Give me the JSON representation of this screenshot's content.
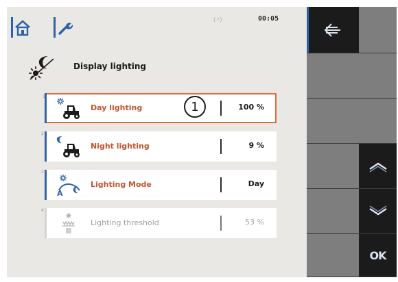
{
  "header": {
    "signal": "(ᵍ)",
    "clock": "00:05"
  },
  "page": {
    "title": "Display lighting"
  },
  "items": [
    {
      "index": "1",
      "label": "Day lighting",
      "value": "100 %",
      "icon": "day-lighting-tractor-icon",
      "state": "selected"
    },
    {
      "index": "2",
      "label": "Night lighting",
      "value": "9 %",
      "icon": "night-lighting-tractor-icon",
      "state": "normal"
    },
    {
      "index": "3",
      "label": "Lighting Mode",
      "value": "Day",
      "icon": "lighting-mode-icon",
      "state": "normal"
    },
    {
      "index": "4",
      "label": "Lighting threshold",
      "value": "53 %",
      "icon": "lighting-threshold-icon",
      "state": "disabled"
    }
  ],
  "callout": "1",
  "softkeys": {
    "back": "back-arrow-icon",
    "up": "chevron-up-icon",
    "down": "chevron-down-icon",
    "ok": "OK"
  },
  "colors": {
    "accent_blue": "#2e62a8",
    "label_orange": "#c45331",
    "selection_orange": "#dd6b3d",
    "panel_bg": "#e9e8e5",
    "softkey_dark": "#1b1b1b"
  }
}
